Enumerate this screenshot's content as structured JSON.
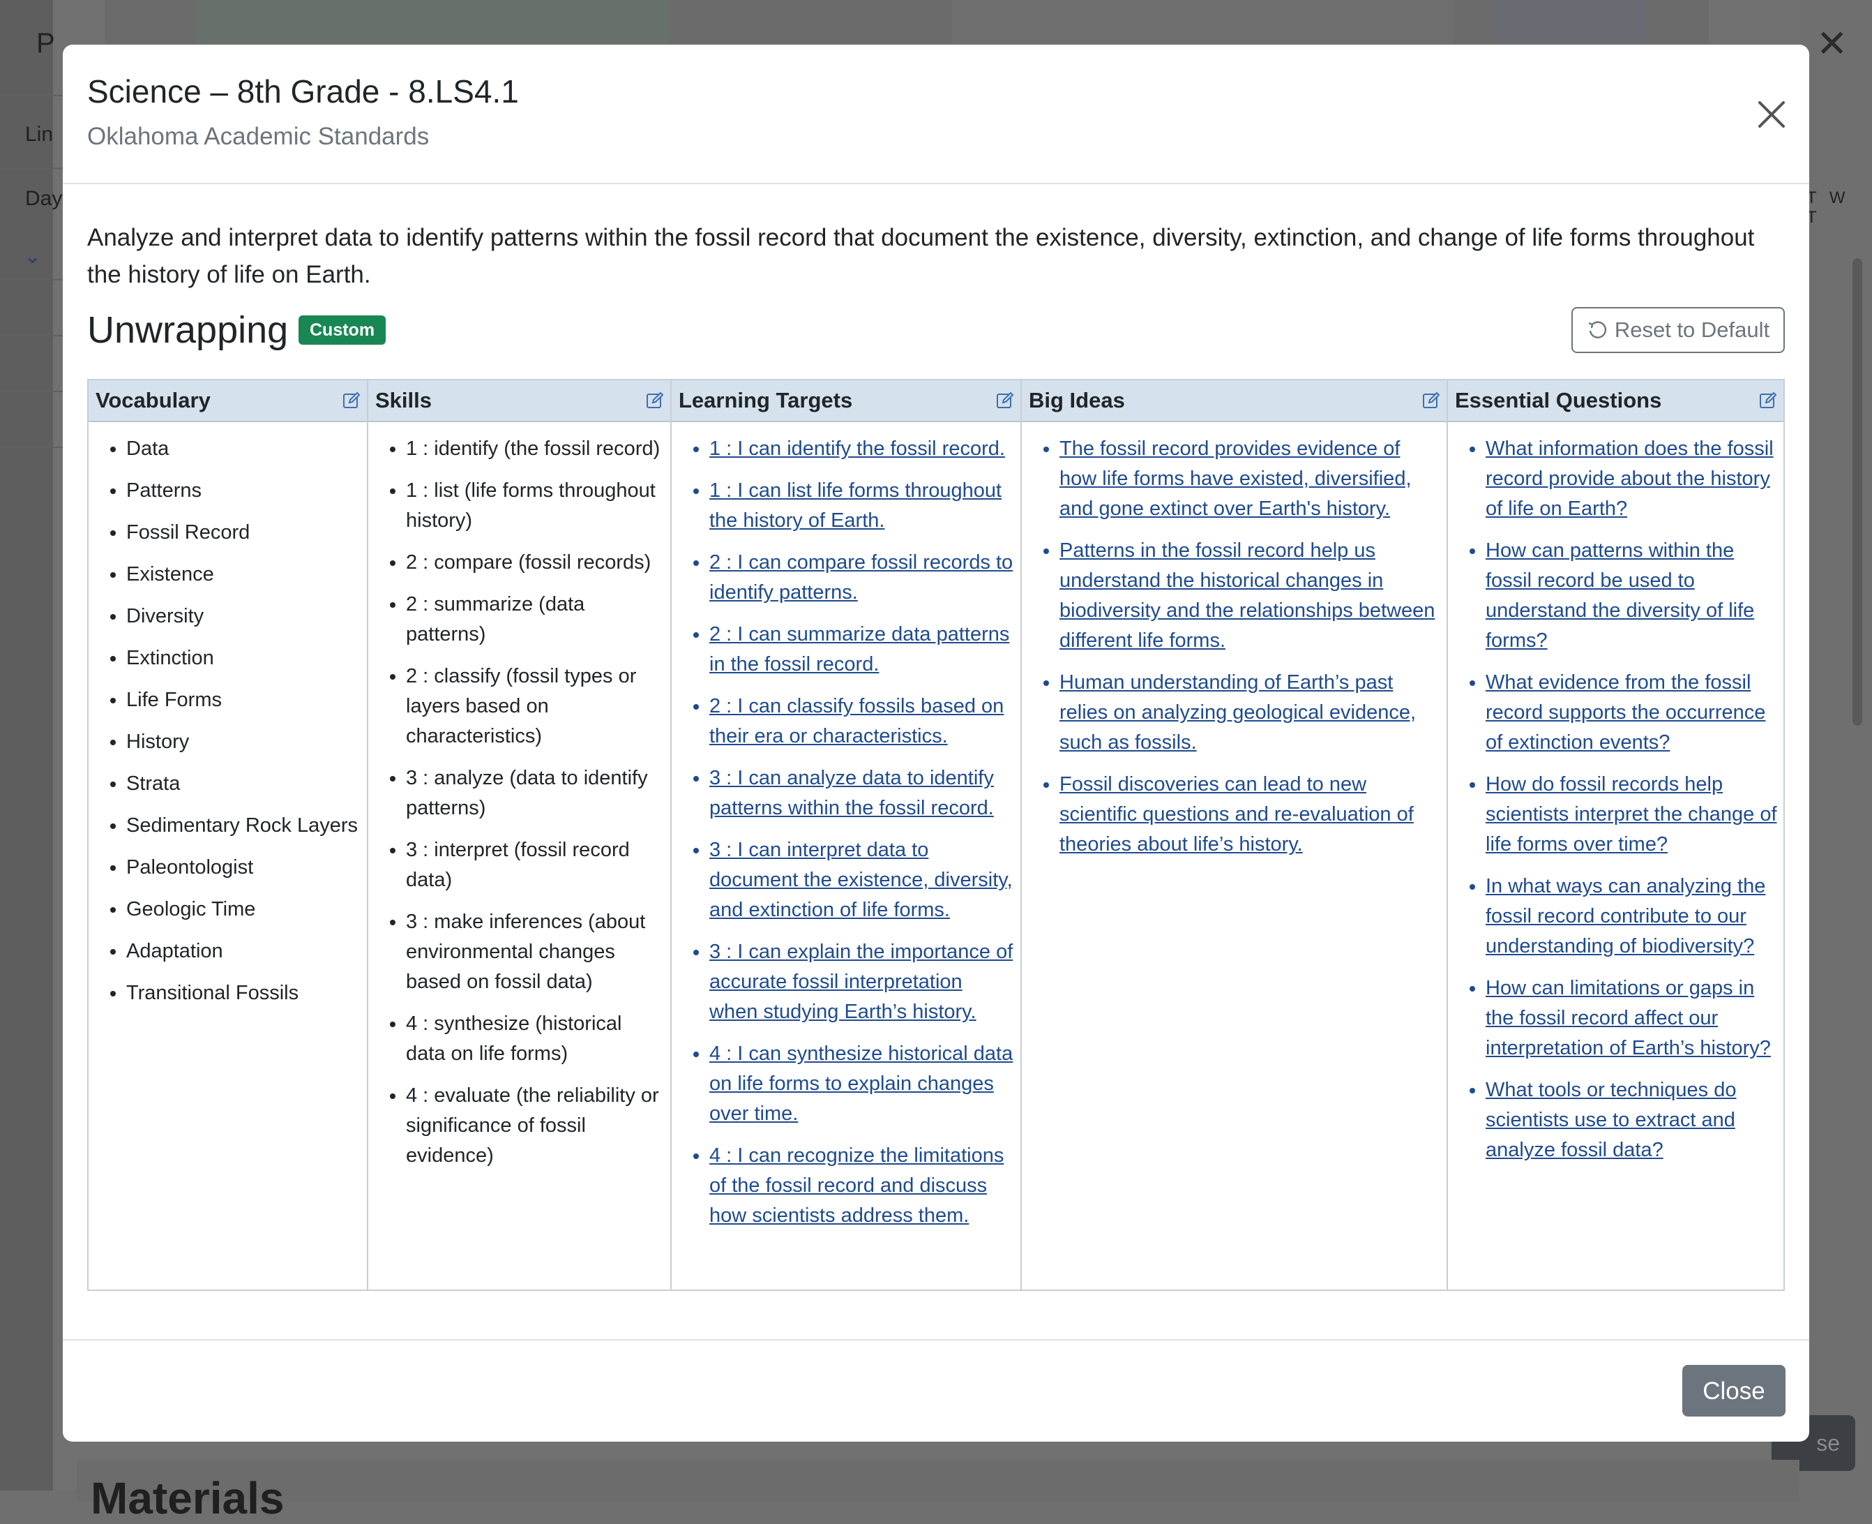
{
  "background": {
    "header_letter": "P",
    "left_labels": [
      "Lin",
      "Day"
    ],
    "weekdays": "T W T",
    "close_fragment": "se",
    "section_title": "Materials"
  },
  "modal": {
    "title": "Science – 8th Grade - 8.LS4.1",
    "subtitle": "Oklahoma Academic Standards",
    "description": "Analyze and interpret data to identify patterns within the fossil record that document the existence, diversity, extinction, and change of life forms throughout the history of life on Earth.",
    "section_title": "Unwrapping",
    "badge": "Custom",
    "reset_label": "Reset to Default",
    "close_label": "Close",
    "accent_color": "#198754",
    "header_bg_color": "#d5e1ec",
    "columns": [
      {
        "header": "Vocabulary",
        "items": [
          "Data",
          "Patterns",
          "Fossil Record",
          "Existence",
          "Diversity",
          "Extinction",
          "Life Forms",
          "History",
          "Strata",
          "Sedimentary Rock Layers",
          "Paleontologist",
          "Geologic Time",
          "Adaptation",
          "Transitional Fossils"
        ]
      },
      {
        "header": "Skills",
        "items": [
          "1 : identify (the fossil record)",
          "1 : list (life forms throughout history)",
          "2 : compare (fossil records)",
          "2 : summarize (data patterns)",
          "2 : classify (fossil types or layers based on characteristics)",
          "3 : analyze (data to identify patterns)",
          "3 : interpret (fossil record data)",
          "3 : make inferences (about environmental changes based on fossil data)",
          "4 : synthesize (historical data on life forms)",
          "4 : evaluate (the reliability or significance of fossil evidence)"
        ]
      },
      {
        "header": "Learning Targets",
        "items": [
          "1 : I can identify the fossil record.",
          "1 : I can list life forms throughout the history of Earth.",
          "2 : I can compare fossil records to identify patterns.",
          "2 : I can summarize data patterns in the fossil record.",
          "2 : I can classify fossils based on their era or characteristics.",
          "3 : I can analyze data to identify patterns within the fossil record.",
          "3 : I can interpret data to document the existence, diversity, and extinction of life forms.",
          "3 : I can explain the importance of accurate fossil interpretation when studying Earth’s history.",
          "4 : I can synthesize historical data on life forms to explain changes over time.",
          "4 : I can recognize the limitations of the fossil record and discuss how scientists address them."
        ]
      },
      {
        "header": "Big Ideas",
        "items": [
          "The fossil record provides evidence of how life forms have existed, diversified, and gone extinct over Earth's history.",
          "Patterns in the fossil record help us understand the historical changes in biodiversity and the relationships between different life forms.",
          "Human understanding of Earth’s past relies on analyzing geological evidence, such as fossils.",
          "Fossil discoveries can lead to new scientific questions and re-evaluation of theories about life’s history."
        ]
      },
      {
        "header": "Essential Questions",
        "items": [
          "What information does the fossil record provide about the history of life on Earth?",
          "How can patterns within the fossil record be used to understand the diversity of life forms?",
          "What evidence from the fossil record supports the occurrence of extinction events?",
          "How do fossil records help scientists interpret the change of life forms over time?",
          "In what ways can analyzing the fossil record contribute to our understanding of biodiversity?",
          "How can limitations or gaps in the fossil record affect our interpretation of Earth’s history?",
          "What tools or techniques do scientists use to extract and analyze fossil data?"
        ]
      }
    ]
  }
}
